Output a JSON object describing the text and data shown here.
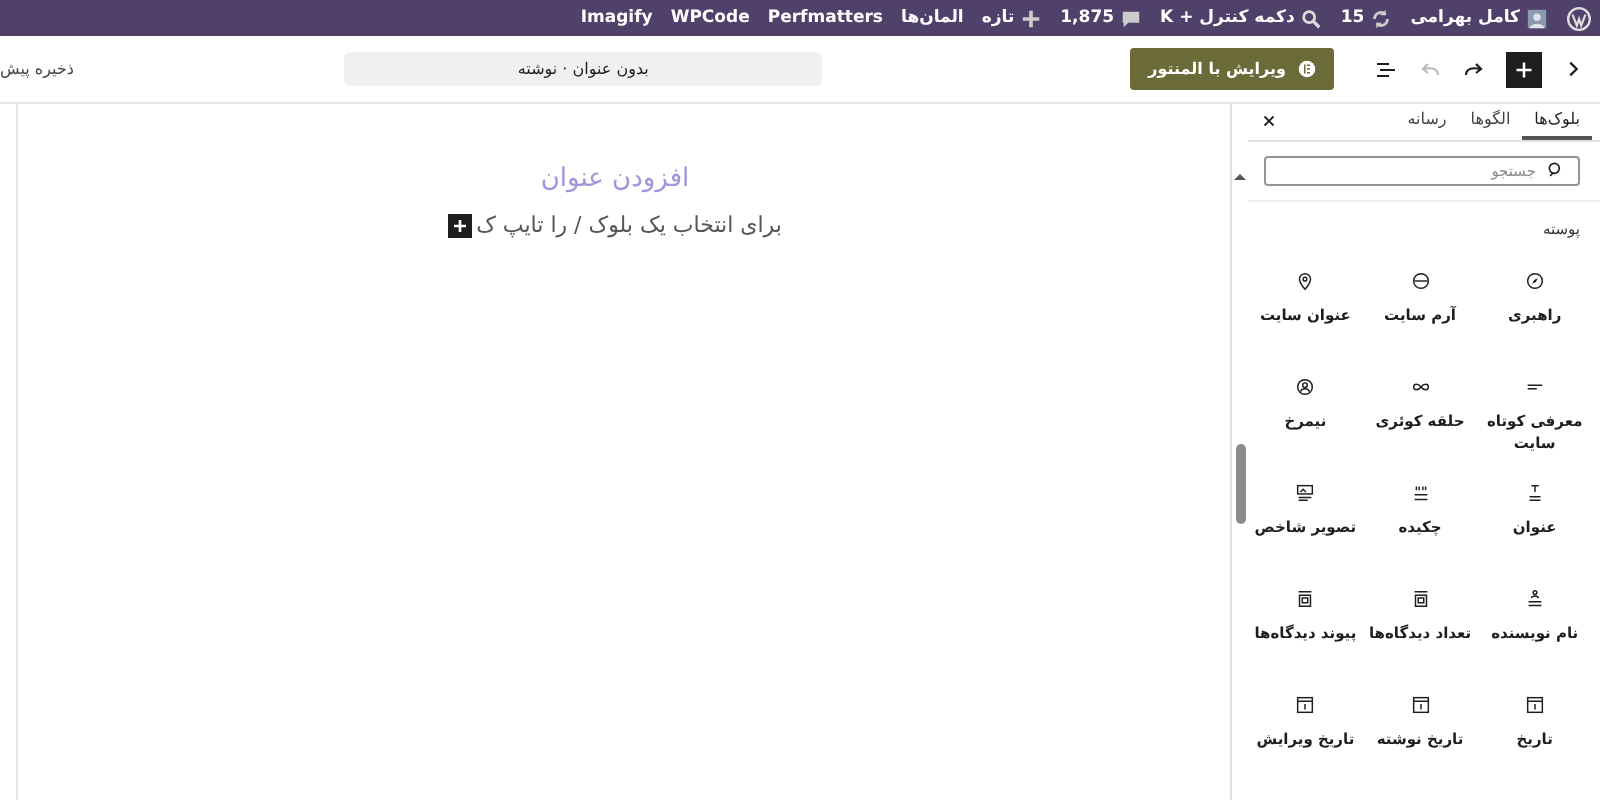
{
  "admin_bar": {
    "items": [
      {
        "kind": "logo"
      },
      {
        "kind": "user",
        "label": "کامل بهرامی"
      },
      {
        "kind": "updates",
        "label": "15"
      },
      {
        "kind": "search",
        "label": "دکمه کنترل + K"
      },
      {
        "kind": "comments",
        "label": "1,875"
      },
      {
        "kind": "new",
        "label": "تازه"
      },
      {
        "kind": "text",
        "label": "المان‌ها"
      },
      {
        "kind": "text",
        "label": "Perfmatters"
      },
      {
        "kind": "text",
        "label": "WPCode"
      },
      {
        "kind": "text",
        "label": "Imagify"
      }
    ]
  },
  "toolbar": {
    "undo": {
      "disabled": true
    },
    "redo": {
      "disabled": false
    },
    "elementor_button": "ویرایش با المنتور",
    "document_title": "بدون عنوان · نوشته",
    "save_draft": "ذخیره پیش"
  },
  "canvas": {
    "title_placeholder": "افزودن عنوان",
    "paragraph_placeholder": "برای انتخاب یک بلوک / را تایپ ک"
  },
  "sidebar": {
    "tabs": [
      {
        "label": "بلوک‌ها",
        "selected": true
      },
      {
        "label": "الگوها",
        "selected": false
      },
      {
        "label": "رسانه",
        "selected": false
      }
    ],
    "search": {
      "placeholder": "جستجو"
    },
    "category": "پوسته",
    "blocks": [
      "راهبری",
      "آرم سایت",
      "عنوان سایت",
      "معرفی کوتاه سایت",
      "حلقه کوئری",
      "نیمرخ",
      "عنوان",
      "چکیده",
      "تصویر شاخص",
      "نام نویسنده",
      "تعداد دیدگاه‌ها",
      "پیوند دیدگاه‌ها",
      "تاریخ",
      "تاریخ نوشته",
      "تاریخ ویرایش"
    ]
  }
}
